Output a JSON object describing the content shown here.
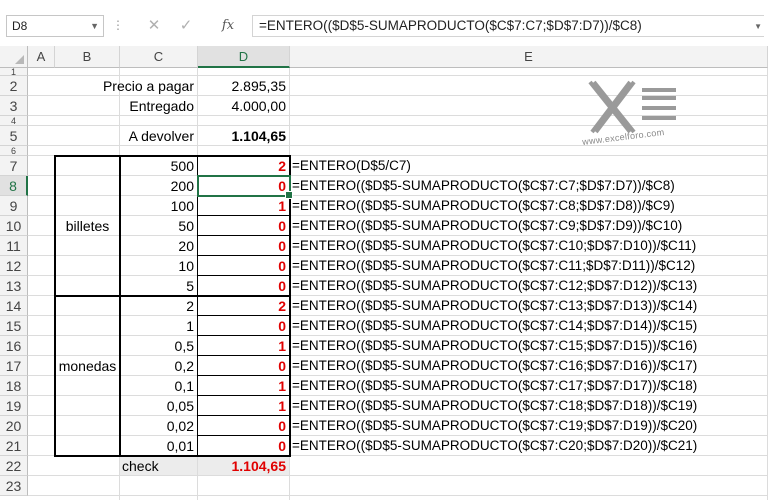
{
  "formula_bar": {
    "name_box": "D8",
    "cancel_icon": "✕",
    "enter_icon": "✓",
    "fx_label": "fx",
    "formula": "=ENTERO(($D$5-SUMAPRODUCTO($C$7:C7;$D$7:D7))/$C8)"
  },
  "columns": [
    "A",
    "B",
    "C",
    "D",
    "E"
  ],
  "active_column": "D",
  "active_row": "8",
  "rows": [
    "1",
    "2",
    "3",
    "4",
    "5",
    "6",
    "7",
    "8",
    "9",
    "10",
    "11",
    "12",
    "13",
    "14",
    "15",
    "16",
    "17",
    "18",
    "19",
    "20",
    "21",
    "22",
    "23"
  ],
  "summary": {
    "precio_label": "Precio a pagar",
    "precio_value": "2.895,35",
    "entregado_label": "Entregado",
    "entregado_value": "4.000,00",
    "devolver_label": "A devolver",
    "devolver_value": "1.104,65"
  },
  "logo": {
    "text": "www.excelforo.com"
  },
  "groups": {
    "billetes": "billetes",
    "monedas": "monedas"
  },
  "table": [
    {
      "denom": "500",
      "qty": "2",
      "formula": "=ENTERO(D$5/C7)"
    },
    {
      "denom": "200",
      "qty": "0",
      "formula": "=ENTERO(($D$5-SUMAPRODUCTO($C$7:C7;$D$7:D7))/$C8)"
    },
    {
      "denom": "100",
      "qty": "1",
      "formula": "=ENTERO(($D$5-SUMAPRODUCTO($C$7:C8;$D$7:D8))/$C9)"
    },
    {
      "denom": "50",
      "qty": "0",
      "formula": "=ENTERO(($D$5-SUMAPRODUCTO($C$7:C9;$D$7:D9))/$C10)"
    },
    {
      "denom": "20",
      "qty": "0",
      "formula": "=ENTERO(($D$5-SUMAPRODUCTO($C$7:C10;$D$7:D10))/$C11)"
    },
    {
      "denom": "10",
      "qty": "0",
      "formula": "=ENTERO(($D$5-SUMAPRODUCTO($C$7:C11;$D$7:D11))/$C12)"
    },
    {
      "denom": "5",
      "qty": "0",
      "formula": "=ENTERO(($D$5-SUMAPRODUCTO($C$7:C12;$D$7:D12))/$C13)"
    },
    {
      "denom": "2",
      "qty": "2",
      "formula": "=ENTERO(($D$5-SUMAPRODUCTO($C$7:C13;$D$7:D13))/$C14)"
    },
    {
      "denom": "1",
      "qty": "0",
      "formula": "=ENTERO(($D$5-SUMAPRODUCTO($C$7:C14;$D$7:D14))/$C15)"
    },
    {
      "denom": "0,5",
      "qty": "1",
      "formula": "=ENTERO(($D$5-SUMAPRODUCTO($C$7:C15;$D$7:D15))/$C16)"
    },
    {
      "denom": "0,2",
      "qty": "0",
      "formula": "=ENTERO(($D$5-SUMAPRODUCTO($C$7:C16;$D$7:D16))/$C17)"
    },
    {
      "denom": "0,1",
      "qty": "1",
      "formula": "=ENTERO(($D$5-SUMAPRODUCTO($C$7:C17;$D$7:D17))/$C18)"
    },
    {
      "denom": "0,05",
      "qty": "1",
      "formula": "=ENTERO(($D$5-SUMAPRODUCTO($C$7:C18;$D$7:D18))/$C19)"
    },
    {
      "denom": "0,02",
      "qty": "0",
      "formula": "=ENTERO(($D$5-SUMAPRODUCTO($C$7:C19;$D$7:D19))/$C20)"
    },
    {
      "denom": "0,01",
      "qty": "0",
      "formula": "=ENTERO(($D$5-SUMAPRODUCTO($C$7:C20;$D$7:D20))/$C21)"
    }
  ],
  "check": {
    "label": "check",
    "value": "1.104,65"
  },
  "colors": {
    "accent": "#217346",
    "result_red": "#e00000",
    "header_bg": "#f3f3f3"
  }
}
